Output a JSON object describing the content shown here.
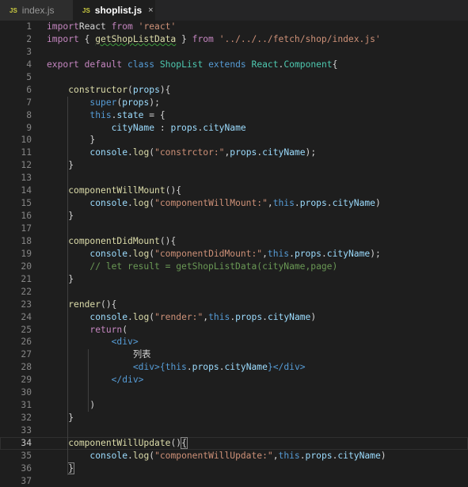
{
  "tabs": [
    {
      "badge": "JS",
      "name": "index.js",
      "active": false
    },
    {
      "badge": "JS",
      "name": "shoplist.js",
      "active": true,
      "close": "×"
    }
  ],
  "current_line": 34,
  "lines": [
    {
      "n": "1",
      "t": [
        [
          "kw",
          "import"
        ],
        [
          "",
          "React "
        ],
        [
          "kw",
          "from"
        ],
        [
          "",
          " "
        ],
        [
          "str",
          "'react'"
        ]
      ]
    },
    {
      "n": "2",
      "t": [
        [
          "kw",
          "import"
        ],
        [
          "",
          "",
          " "
        ],
        [
          "",
          " { "
        ],
        [
          "fn sq",
          "getShopListData"
        ],
        [
          "",
          " } "
        ],
        [
          "kw",
          "from"
        ],
        [
          "",
          " "
        ],
        [
          "str",
          "'../../../fetch/shop/index.js'"
        ]
      ]
    },
    {
      "n": "3",
      "t": []
    },
    {
      "n": "4",
      "t": [
        [
          "kw",
          "export"
        ],
        [
          "",
          " "
        ],
        [
          "kw",
          "default"
        ],
        [
          "",
          " "
        ],
        [
          "kw2",
          "class"
        ],
        [
          "",
          " "
        ],
        [
          "cls",
          "ShopList"
        ],
        [
          "",
          " "
        ],
        [
          "kw2",
          "extends"
        ],
        [
          "",
          " "
        ],
        [
          "cls",
          "React"
        ],
        [
          "",
          "."
        ],
        [
          "cls",
          "Component"
        ],
        [
          "",
          "{"
        ]
      ]
    },
    {
      "n": "5",
      "t": []
    },
    {
      "n": "6",
      "t": [
        [
          "",
          "    "
        ],
        [
          "fn",
          "constructor"
        ],
        [
          "",
          "("
        ],
        [
          "var",
          "props"
        ],
        [
          "",
          "){"
        ]
      ]
    },
    {
      "n": "7",
      "t": [
        [
          "",
          "        "
        ],
        [
          "kw2",
          "super"
        ],
        [
          "",
          "("
        ],
        [
          "var",
          "props"
        ],
        [
          "",
          ");"
        ]
      ]
    },
    {
      "n": "8",
      "t": [
        [
          "",
          "        "
        ],
        [
          "kw2",
          "this"
        ],
        [
          "",
          "."
        ],
        [
          "var",
          "state"
        ],
        [
          "",
          " = {"
        ]
      ]
    },
    {
      "n": "9",
      "t": [
        [
          "",
          "            "
        ],
        [
          "var",
          "cityName"
        ],
        [
          "",
          " : "
        ],
        [
          "var",
          "props"
        ],
        [
          "",
          "."
        ],
        [
          "var",
          "cityName"
        ]
      ]
    },
    {
      "n": "10",
      "t": [
        [
          "",
          "        }"
        ]
      ]
    },
    {
      "n": "11",
      "t": [
        [
          "",
          "        "
        ],
        [
          "var",
          "console"
        ],
        [
          "",
          "."
        ],
        [
          "fn",
          "log"
        ],
        [
          "",
          "("
        ],
        [
          "str",
          "\"constrctor:\""
        ],
        [
          "",
          ","
        ],
        [
          "var",
          "props"
        ],
        [
          "",
          "."
        ],
        [
          "var",
          "cityName"
        ],
        [
          "",
          ");"
        ]
      ]
    },
    {
      "n": "12",
      "t": [
        [
          "",
          "    }"
        ]
      ]
    },
    {
      "n": "13",
      "t": []
    },
    {
      "n": "14",
      "t": [
        [
          "",
          "    "
        ],
        [
          "fn",
          "componentWillMount"
        ],
        [
          "",
          "(){"
        ]
      ]
    },
    {
      "n": "15",
      "t": [
        [
          "",
          "        "
        ],
        [
          "var",
          "console"
        ],
        [
          "",
          "."
        ],
        [
          "fn",
          "log"
        ],
        [
          "",
          "("
        ],
        [
          "str",
          "\"componentWillMount:\""
        ],
        [
          "",
          ","
        ],
        [
          "kw2",
          "this"
        ],
        [
          "",
          "."
        ],
        [
          "var",
          "props"
        ],
        [
          "",
          "."
        ],
        [
          "var",
          "cityName"
        ],
        [
          "",
          ")"
        ]
      ]
    },
    {
      "n": "16",
      "t": [
        [
          "",
          "    }"
        ]
      ]
    },
    {
      "n": "17",
      "t": []
    },
    {
      "n": "18",
      "t": [
        [
          "",
          "    "
        ],
        [
          "fn",
          "componentDidMount"
        ],
        [
          "",
          "(){"
        ]
      ]
    },
    {
      "n": "19",
      "t": [
        [
          "",
          "        "
        ],
        [
          "var",
          "console"
        ],
        [
          "",
          "."
        ],
        [
          "fn",
          "log"
        ],
        [
          "",
          "("
        ],
        [
          "str",
          "\"componentDidMount:\""
        ],
        [
          "",
          ","
        ],
        [
          "kw2",
          "this"
        ],
        [
          "",
          "."
        ],
        [
          "var",
          "props"
        ],
        [
          "",
          "."
        ],
        [
          "var",
          "cityName"
        ],
        [
          "",
          ");"
        ]
      ]
    },
    {
      "n": "20",
      "t": [
        [
          "",
          "        "
        ],
        [
          "cmt",
          "// let result = getShopListData(cityName,page)"
        ]
      ]
    },
    {
      "n": "21",
      "t": [
        [
          "",
          "    }"
        ]
      ]
    },
    {
      "n": "22",
      "t": []
    },
    {
      "n": "23",
      "t": [
        [
          "",
          "    "
        ],
        [
          "fn",
          "render"
        ],
        [
          "",
          "(){"
        ]
      ]
    },
    {
      "n": "24",
      "t": [
        [
          "",
          "        "
        ],
        [
          "var",
          "console"
        ],
        [
          "",
          "."
        ],
        [
          "fn",
          "log"
        ],
        [
          "",
          "("
        ],
        [
          "str",
          "\"render:\""
        ],
        [
          "",
          ","
        ],
        [
          "kw2",
          "this"
        ],
        [
          "",
          "."
        ],
        [
          "var",
          "props"
        ],
        [
          "",
          "."
        ],
        [
          "var",
          "cityName"
        ],
        [
          "",
          ")"
        ]
      ]
    },
    {
      "n": "25",
      "t": [
        [
          "",
          "        "
        ],
        [
          "kw",
          "return"
        ],
        [
          "",
          "("
        ]
      ]
    },
    {
      "n": "26",
      "t": [
        [
          "",
          "            "
        ],
        [
          "tag",
          "<div>"
        ]
      ]
    },
    {
      "n": "27",
      "t": [
        [
          "",
          "                列表"
        ]
      ]
    },
    {
      "n": "28",
      "t": [
        [
          "",
          "                "
        ],
        [
          "tag",
          "<div>"
        ],
        [
          "kw2",
          "{this"
        ],
        [
          "",
          "."
        ],
        [
          "var",
          "props"
        ],
        [
          "",
          "."
        ],
        [
          "var",
          "cityName"
        ],
        [
          "kw2",
          "}"
        ],
        [
          "tag",
          "</div>"
        ]
      ]
    },
    {
      "n": "29",
      "t": [
        [
          "",
          "            "
        ],
        [
          "tag",
          "</div>"
        ]
      ]
    },
    {
      "n": "30",
      "t": []
    },
    {
      "n": "31",
      "t": [
        [
          "",
          "        )"
        ]
      ]
    },
    {
      "n": "32",
      "t": [
        [
          "",
          "    }"
        ]
      ]
    },
    {
      "n": "33",
      "t": []
    },
    {
      "n": "34",
      "t": [
        [
          "",
          "    "
        ],
        [
          "fn",
          "componentWillUpdate"
        ],
        [
          "",
          "()"
        ],
        [
          "bm",
          "{"
        ]
      ]
    },
    {
      "n": "35",
      "t": [
        [
          "",
          "        "
        ],
        [
          "var",
          "console"
        ],
        [
          "",
          "."
        ],
        [
          "fn",
          "log"
        ],
        [
          "",
          "("
        ],
        [
          "str",
          "\"componentWillUpdate:\""
        ],
        [
          "",
          ","
        ],
        [
          "kw2",
          "this"
        ],
        [
          "",
          "."
        ],
        [
          "var",
          "props"
        ],
        [
          "",
          "."
        ],
        [
          "var",
          "cityName"
        ],
        [
          "",
          ")"
        ]
      ]
    },
    {
      "n": "36",
      "t": [
        [
          "",
          "    "
        ],
        [
          "bm",
          "}"
        ]
      ]
    },
    {
      "n": "37",
      "t": []
    }
  ]
}
